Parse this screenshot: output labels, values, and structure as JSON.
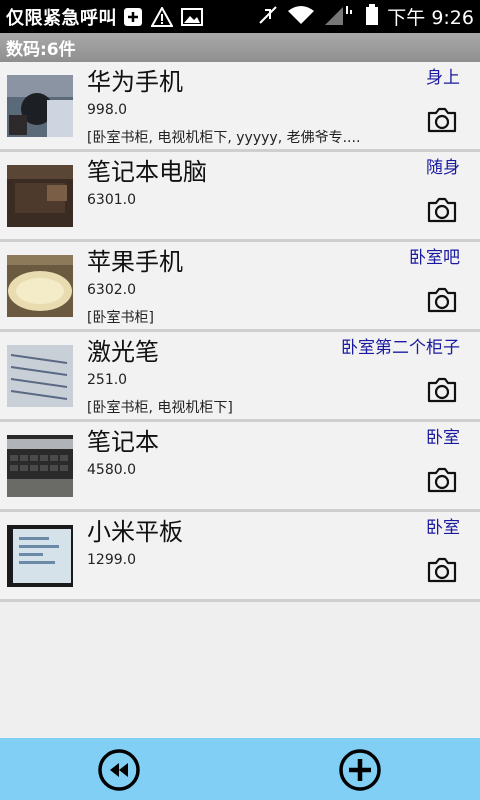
{
  "status_bar": {
    "carrier_text": "仅限紧急呼叫",
    "time": "下午 9:26",
    "icons": [
      "add-box-icon",
      "warning-icon",
      "image-icon",
      "mute-icon",
      "wifi-icon",
      "signal-icon",
      "battery-icon"
    ]
  },
  "header": {
    "title": "数码:6件"
  },
  "items": [
    {
      "title": "华为手机",
      "price": "998.0",
      "tags": "[卧室书柜, 电视机柜下, yyyyy, 老佛爷专....",
      "location": "身上"
    },
    {
      "title": "笔记本电脑",
      "price": "6301.0",
      "tags": "",
      "location": "随身"
    },
    {
      "title": "苹果手机",
      "price": "6302.0",
      "tags": "[卧室书柜]",
      "location": "卧室吧"
    },
    {
      "title": "激光笔",
      "price": "251.0",
      "tags": "[卧室书柜, 电视机柜下]",
      "location": "卧室第二个柜子"
    },
    {
      "title": "笔记本",
      "price": "4580.0",
      "tags": "",
      "location": "卧室"
    },
    {
      "title": "小米平板",
      "price": "1299.0",
      "tags": "",
      "location": "卧室"
    }
  ],
  "colors": {
    "bottom_bar": "#82cff5",
    "location_text": "#1a1aa0",
    "header_bg": "#999999"
  }
}
